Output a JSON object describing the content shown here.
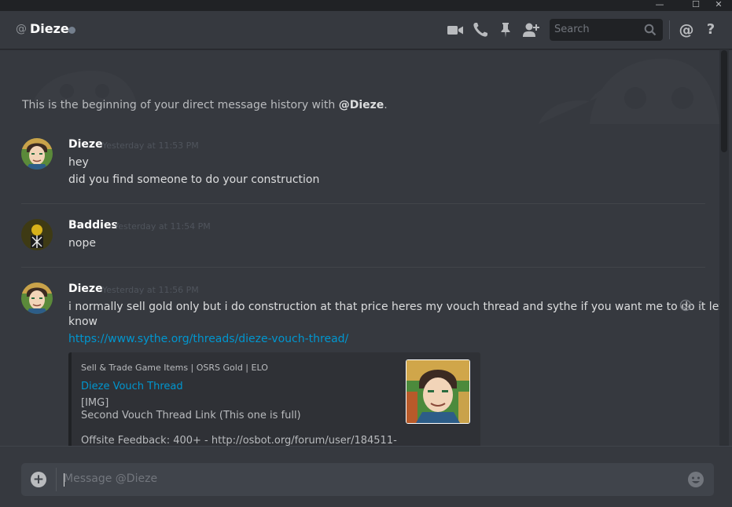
{
  "window": {
    "minimize": "—",
    "maximize": "☐",
    "close": "✕"
  },
  "header": {
    "at_symbol": "@",
    "name": "Dieze",
    "search_placeholder": "Search",
    "mention_symbol": "@",
    "help_symbol": "?"
  },
  "chat": {
    "beginning_prefix": "This is the beginning of your direct message history with ",
    "beginning_name": "@Dieze",
    "beginning_suffix": ".",
    "messages": [
      {
        "author": "Dieze",
        "timestamp": "Yesterday at 11:53 PM",
        "lines": [
          "hey",
          "did you find someone to do your construction"
        ]
      },
      {
        "author": "Baddies",
        "timestamp": "Yesterday at 11:54 PM",
        "lines": [
          "nope"
        ]
      },
      {
        "author": "Dieze",
        "timestamp": "Yesterday at 11:56 PM",
        "lines": [
          "i normally sell gold only but i do construction at that price heres my vouch thread and sythe if you want me to do it let me",
          "know"
        ],
        "link": "https://www.sythe.org/threads/dieze-vouch-thread/",
        "embed": {
          "provider": "Sell & Trade Game Items | OSRS Gold | ELO",
          "title": "Dieze Vouch Thread",
          "desc": [
            "[IMG]",
            "Second Vouch Thread Link (This one is full)",
            "Offsite Feedback: 400+ - http://osbot.org/forum/user/184511-"
          ]
        }
      }
    ]
  },
  "composer": {
    "placeholder": "Message @Dieze",
    "plus": "+"
  },
  "colors": {
    "background": "#36393f",
    "link": "#0096cf",
    "header_dark": "#202225"
  },
  "icons": [
    "video-call-icon",
    "phone-call-icon",
    "pin-icon",
    "add-friend-icon",
    "search-icon",
    "mention-icon",
    "help-icon",
    "add-reaction-icon",
    "more-options-icon",
    "add-attachment-icon",
    "emoji-icon"
  ]
}
